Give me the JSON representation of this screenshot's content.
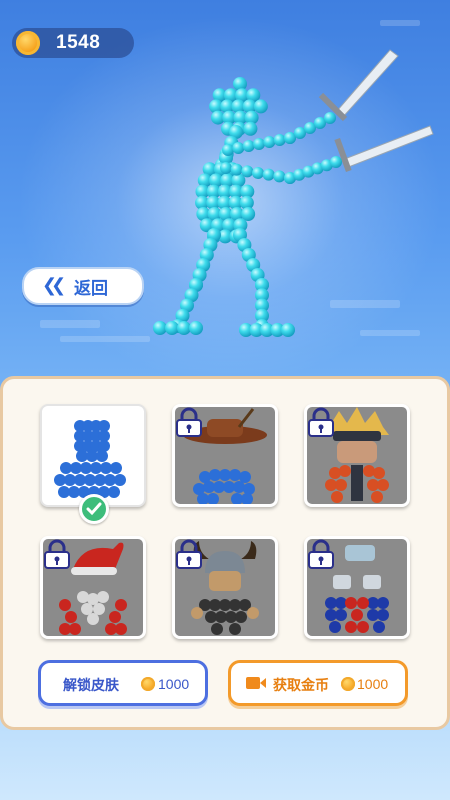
{
  "coins": {
    "value": "1548",
    "icon": "coin-icon"
  },
  "back_button": {
    "label": "返回",
    "icon": "double-chevron-left-icon"
  },
  "skins": [
    {
      "name": "default-skin",
      "status": "selected",
      "colors": [
        "#2c6fd8"
      ]
    },
    {
      "name": "cowboy-skin",
      "status": "locked",
      "colors": [
        "#2c6fd8",
        "#7b3b1c"
      ]
    },
    {
      "name": "ninja-skin",
      "status": "locked",
      "colors": [
        "#d84f23",
        "#2f3440",
        "#e4b84c"
      ]
    },
    {
      "name": "santa-skin",
      "status": "locked",
      "colors": [
        "#c9261f",
        "#d8d8d8"
      ]
    },
    {
      "name": "viking-skin",
      "status": "locked",
      "colors": [
        "#333333",
        "#c29a6a"
      ]
    },
    {
      "name": "robot-skin",
      "status": "locked",
      "colors": [
        "#c9261f",
        "#1e3aa8"
      ]
    }
  ],
  "actions": {
    "unlock": {
      "label": "解锁皮肤",
      "cost": "1000",
      "color": "#4d6fe0"
    },
    "earn": {
      "label": "获取金币",
      "cost": "1000",
      "icon": "video-icon",
      "color": "#f39a2a"
    }
  }
}
